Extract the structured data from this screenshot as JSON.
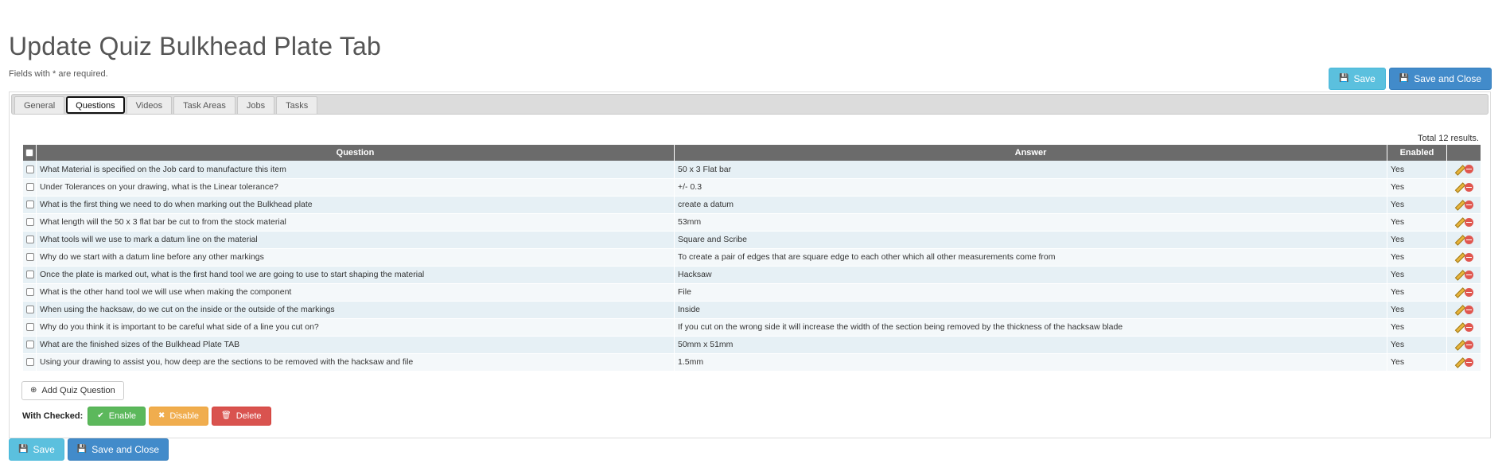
{
  "page": {
    "title": "Update Quiz Bulkhead Plate Tab",
    "required_note": "Fields with * are required."
  },
  "actions": {
    "save_label": "Save",
    "save_close_label": "Save and Close"
  },
  "tabs": [
    {
      "label": "General",
      "active": false
    },
    {
      "label": "Questions",
      "active": true
    },
    {
      "label": "Videos",
      "active": false
    },
    {
      "label": "Task Areas",
      "active": false
    },
    {
      "label": "Jobs",
      "active": false
    },
    {
      "label": "Tasks",
      "active": false
    }
  ],
  "grid": {
    "total": "Total 12 results.",
    "columns": {
      "question": "Question",
      "answer": "Answer",
      "enabled": "Enabled"
    },
    "rows": [
      {
        "question": "What Material is specified on the Job card to manufacture this item",
        "answer": "50 x 3 Flat bar",
        "enabled": "Yes"
      },
      {
        "question": "Under Tolerances on your drawing, what is the Linear tolerance?",
        "answer": "+/- 0.3",
        "enabled": "Yes"
      },
      {
        "question": "What is the first thing we need to do when marking out the Bulkhead plate",
        "answer": "create a datum",
        "enabled": "Yes"
      },
      {
        "question": "What length will the 50 x 3 flat bar be cut to from the stock material",
        "answer": "53mm",
        "enabled": "Yes"
      },
      {
        "question": "What tools will we use to mark a datum line on the material",
        "answer": "Square and Scribe",
        "enabled": "Yes"
      },
      {
        "question": "Why do we start with a datum line before any other markings",
        "answer": "To create a pair of edges that are square edge to each other which all other measurements come from",
        "enabled": "Yes"
      },
      {
        "question": "Once the plate is marked out, what is the first hand tool we are going to use to start shaping the material",
        "answer": "Hacksaw",
        "enabled": "Yes"
      },
      {
        "question": "What is the other hand tool we will use when making the component",
        "answer": "File",
        "enabled": "Yes"
      },
      {
        "question": "When using the hacksaw, do we cut on the inside or the outside of the markings",
        "answer": "Inside",
        "enabled": "Yes"
      },
      {
        "question": "Why do you think it is important to be careful what side of a line you cut on?",
        "answer": "If you cut on the wrong side it will increase the width of the section being removed by the thickness of the hacksaw blade",
        "enabled": "Yes"
      },
      {
        "question": "What are the finished sizes of the Bulkhead Plate TAB",
        "answer": "50mm x 51mm",
        "enabled": "Yes"
      },
      {
        "question": "Using your drawing to assist you, how deep are the sections to be removed with the hacksaw and file",
        "answer": "1.5mm",
        "enabled": "Yes"
      }
    ]
  },
  "add_question_label": "Add Quiz Question",
  "bulk": {
    "label": "With Checked:",
    "enable_label": "Enable",
    "disable_label": "Disable",
    "delete_label": "Delete"
  },
  "icons": {
    "save": "floppy-disk-icon",
    "add": "plus-circle-icon",
    "enable": "check-icon",
    "disable": "x-icon",
    "delete": "trash-icon",
    "edit": "pencil-icon",
    "remove": "minus-circle-icon"
  }
}
